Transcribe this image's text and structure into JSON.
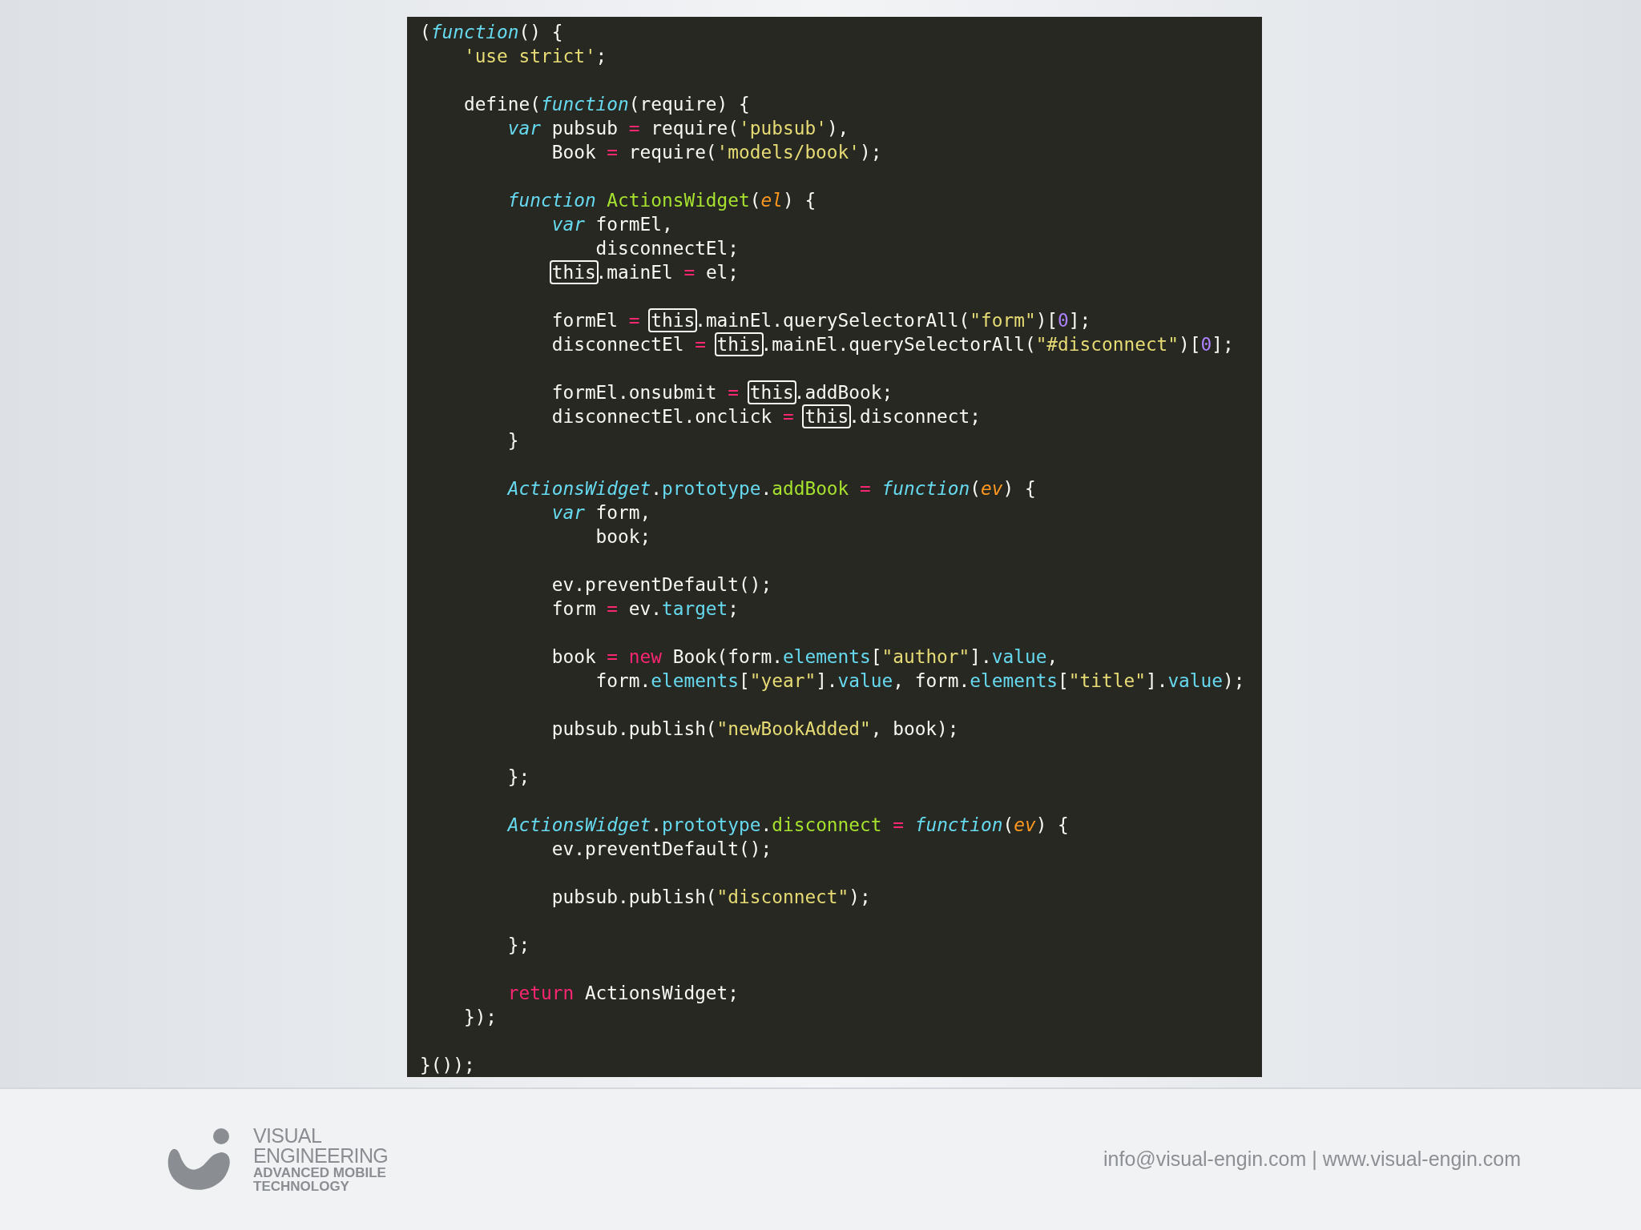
{
  "code_blocks": [
    [
      [
        {
          "kind": "plain",
          "text": "("
        },
        {
          "kind": "storage",
          "text": "function"
        },
        {
          "kind": "plain",
          "text": "() {"
        }
      ],
      [
        {
          "kind": "str",
          "text": "    'use strict'"
        },
        {
          "kind": "plain",
          "text": ";"
        }
      ]
    ],
    [
      [
        {
          "kind": "plain",
          "text": "    define("
        },
        {
          "kind": "storage",
          "text": "function"
        },
        {
          "kind": "plain",
          "text": "(require) {"
        }
      ],
      [
        {
          "kind": "storage",
          "text": "        var"
        },
        {
          "kind": "plain",
          "text": " pubsub "
        },
        {
          "kind": "op",
          "text": "="
        },
        {
          "kind": "plain",
          "text": " require("
        },
        {
          "kind": "str",
          "text": "'pubsub'"
        },
        {
          "kind": "plain",
          "text": "),"
        }
      ],
      [
        {
          "kind": "plain",
          "text": "            Book "
        },
        {
          "kind": "op",
          "text": "="
        },
        {
          "kind": "plain",
          "text": " require("
        },
        {
          "kind": "str",
          "text": "'models/book'"
        },
        {
          "kind": "plain",
          "text": ");"
        }
      ]
    ],
    [
      [
        {
          "kind": "storage",
          "text": "        function"
        },
        {
          "kind": "entity",
          "text": " ActionsWidget"
        },
        {
          "kind": "plain",
          "text": "("
        },
        {
          "kind": "param",
          "text": "el"
        },
        {
          "kind": "plain",
          "text": ") {"
        }
      ],
      [
        {
          "kind": "storage",
          "text": "            var"
        },
        {
          "kind": "plain",
          "text": " formEl,"
        }
      ],
      [
        {
          "kind": "plain",
          "text": "                disconnectEl;"
        }
      ],
      [
        {
          "kind": "this",
          "text": "            this"
        },
        {
          "kind": "plain",
          "text": ".mainEl "
        },
        {
          "kind": "op",
          "text": "="
        },
        {
          "kind": "plain",
          "text": " el;"
        }
      ]
    ],
    [
      [
        {
          "kind": "plain",
          "text": "            formEl "
        },
        {
          "kind": "op",
          "text": "="
        },
        {
          "kind": "this",
          "text": " this"
        },
        {
          "kind": "plain",
          "text": ".mainEl.querySelectorAll("
        },
        {
          "kind": "str",
          "text": "\"form\""
        },
        {
          "kind": "plain",
          "text": ")["
        },
        {
          "kind": "num",
          "text": "0"
        },
        {
          "kind": "plain",
          "text": "];"
        }
      ],
      [
        {
          "kind": "plain",
          "text": "            disconnectEl "
        },
        {
          "kind": "op",
          "text": "="
        },
        {
          "kind": "this",
          "text": " this"
        },
        {
          "kind": "plain",
          "text": ".mainEl.querySelectorAll("
        },
        {
          "kind": "str",
          "text": "\"#disconnect\""
        },
        {
          "kind": "plain",
          "text": ")["
        },
        {
          "kind": "num",
          "text": "0"
        },
        {
          "kind": "plain",
          "text": "];"
        }
      ]
    ],
    [
      [
        {
          "kind": "plain",
          "text": "            formEl.onsubmit "
        },
        {
          "kind": "op",
          "text": "="
        },
        {
          "kind": "this",
          "text": " this"
        },
        {
          "kind": "plain",
          "text": ".addBook;"
        }
      ],
      [
        {
          "kind": "plain",
          "text": "            disconnectEl.onclick "
        },
        {
          "kind": "op",
          "text": "="
        },
        {
          "kind": "this",
          "text": " this"
        },
        {
          "kind": "plain",
          "text": ".disconnect;"
        }
      ],
      [
        {
          "kind": "plain",
          "text": "        }"
        }
      ]
    ],
    [
      [
        {
          "kind": "storage",
          "text": "        ActionsWidget"
        },
        {
          "kind": "plain",
          "text": "."
        },
        {
          "kind": "support",
          "text": "prototype"
        },
        {
          "kind": "plain",
          "text": "."
        },
        {
          "kind": "entity",
          "text": "addBook"
        },
        {
          "kind": "op",
          "text": " ="
        },
        {
          "kind": "storage",
          "text": " function"
        },
        {
          "kind": "plain",
          "text": "("
        },
        {
          "kind": "param",
          "text": "ev"
        },
        {
          "kind": "plain",
          "text": ") {"
        }
      ],
      [
        {
          "kind": "storage",
          "text": "            var"
        },
        {
          "kind": "plain",
          "text": " form,"
        }
      ],
      [
        {
          "kind": "plain",
          "text": "                book;"
        }
      ]
    ],
    [
      [
        {
          "kind": "plain",
          "text": "            ev.preventDefault();"
        }
      ],
      [
        {
          "kind": "plain",
          "text": "            form "
        },
        {
          "kind": "op",
          "text": "="
        },
        {
          "kind": "plain",
          "text": " ev."
        },
        {
          "kind": "support",
          "text": "target"
        },
        {
          "kind": "plain",
          "text": ";"
        }
      ]
    ],
    [
      [
        {
          "kind": "plain",
          "text": "            book "
        },
        {
          "kind": "op",
          "text": "="
        },
        {
          "kind": "op",
          "text": " new"
        },
        {
          "kind": "plain",
          "text": " Book(form."
        },
        {
          "kind": "support",
          "text": "elements"
        },
        {
          "kind": "plain",
          "text": "["
        },
        {
          "kind": "str",
          "text": "\"author\""
        },
        {
          "kind": "plain",
          "text": "]."
        },
        {
          "kind": "support",
          "text": "value"
        },
        {
          "kind": "plain",
          "text": ","
        }
      ],
      [
        {
          "kind": "plain",
          "text": "                form."
        },
        {
          "kind": "support",
          "text": "elements"
        },
        {
          "kind": "plain",
          "text": "["
        },
        {
          "kind": "str",
          "text": "\"year\""
        },
        {
          "kind": "plain",
          "text": "]."
        },
        {
          "kind": "support",
          "text": "value"
        },
        {
          "kind": "plain",
          "text": ", form."
        },
        {
          "kind": "support",
          "text": "elements"
        },
        {
          "kind": "plain",
          "text": "["
        },
        {
          "kind": "str",
          "text": "\"title\""
        },
        {
          "kind": "plain",
          "text": "]."
        },
        {
          "kind": "support",
          "text": "value"
        },
        {
          "kind": "plain",
          "text": ");"
        }
      ]
    ],
    [
      [
        {
          "kind": "plain",
          "text": "            pubsub.publish("
        },
        {
          "kind": "str",
          "text": "\"newBookAdded\""
        },
        {
          "kind": "plain",
          "text": ", book);"
        }
      ]
    ],
    [
      [
        {
          "kind": "plain",
          "text": "        };"
        }
      ]
    ],
    [
      [
        {
          "kind": "storage",
          "text": "        ActionsWidget"
        },
        {
          "kind": "plain",
          "text": "."
        },
        {
          "kind": "support",
          "text": "prototype"
        },
        {
          "kind": "plain",
          "text": "."
        },
        {
          "kind": "entity",
          "text": "disconnect"
        },
        {
          "kind": "op",
          "text": " ="
        },
        {
          "kind": "storage",
          "text": " function"
        },
        {
          "kind": "plain",
          "text": "("
        },
        {
          "kind": "param",
          "text": "ev"
        },
        {
          "kind": "plain",
          "text": ") {"
        }
      ],
      [
        {
          "kind": "plain",
          "text": "            ev.preventDefault();"
        }
      ]
    ],
    [
      [
        {
          "kind": "plain",
          "text": "            pubsub.publish("
        },
        {
          "kind": "str",
          "text": "\"disconnect\""
        },
        {
          "kind": "plain",
          "text": ");"
        }
      ]
    ],
    [
      [
        {
          "kind": "plain",
          "text": "        };"
        }
      ]
    ],
    [
      [
        {
          "kind": "op",
          "text": "        return"
        },
        {
          "kind": "plain",
          "text": " ActionsWidget;"
        }
      ],
      [
        {
          "kind": "plain",
          "text": "    });"
        }
      ]
    ],
    [
      [
        {
          "kind": "plain",
          "text": "}());"
        }
      ]
    ]
  ],
  "footer": {
    "logo_lines": [
      "VISUAL",
      "ENGINEERING",
      "ADVANCED MOBILE",
      "TECHNOLOGY"
    ],
    "contact": "info@visual-engin.com | www.visual-engin.com"
  }
}
